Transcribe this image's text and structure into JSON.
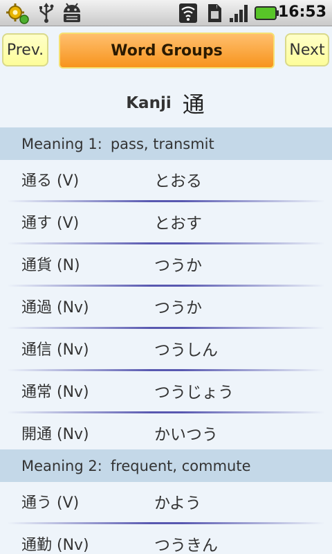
{
  "status": {
    "time": "16:53",
    "icons": [
      "gear-notification-icon",
      "usb-icon",
      "android-debug-icon",
      "wifi-icon",
      "sim-icon",
      "signal-icon",
      "battery-icon"
    ]
  },
  "toolbar": {
    "prev_label": "Prev.",
    "title": "Word Groups",
    "next_label": "Next"
  },
  "heading": {
    "label": "Kanji",
    "kanji": "通"
  },
  "meanings": [
    {
      "title": "Meaning 1:",
      "gloss": "pass, transmit",
      "words": [
        {
          "word": "通る (V)",
          "reading": "とおる"
        },
        {
          "word": "通す (V)",
          "reading": "とおす"
        },
        {
          "word": "通貨 (N)",
          "reading": "つうか"
        },
        {
          "word": "通過 (Nv)",
          "reading": "つうか"
        },
        {
          "word": "通信 (Nv)",
          "reading": "つうしん"
        },
        {
          "word": "通常 (Nv)",
          "reading": "つうじょう"
        },
        {
          "word": "開通 (Nv)",
          "reading": "かいつう"
        }
      ]
    },
    {
      "title": "Meaning 2:",
      "gloss": "frequent, commute",
      "words": [
        {
          "word": "通う (V)",
          "reading": "かよう"
        },
        {
          "word": "通勤 (Nv)",
          "reading": "つうきん"
        }
      ]
    }
  ],
  "colors": {
    "background": "#eef4fa",
    "section_header": "#c4d8e8",
    "title_button": "#f7941d",
    "nav_button": "#fdfd9a",
    "divider": "#5858b0"
  }
}
